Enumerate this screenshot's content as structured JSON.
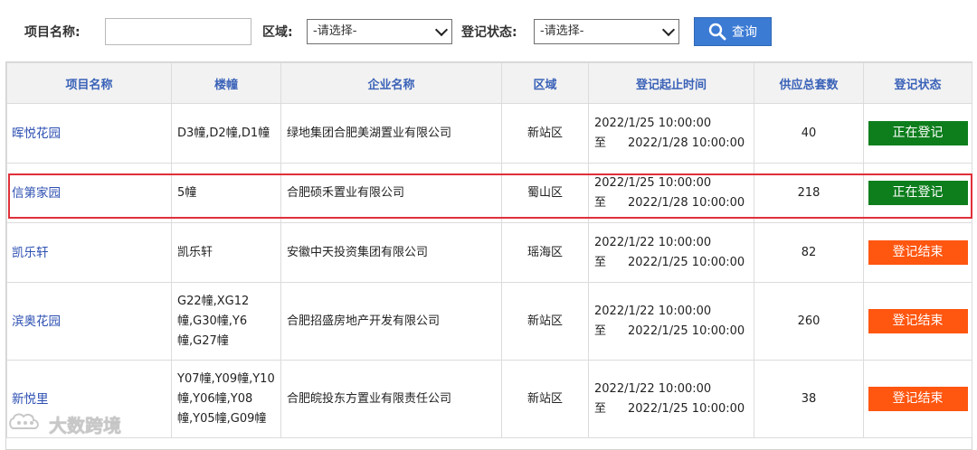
{
  "filters": {
    "project_label": "项目名称:",
    "project_value": "",
    "region_label": "区域:",
    "region_selected": "-请选择-",
    "status_label": "登记状态:",
    "status_selected": "-请选择-",
    "search_label": "查询",
    "search_icon": "search-icon"
  },
  "table": {
    "columns": [
      "项目名称",
      "楼幢",
      "企业名称",
      "区域",
      "登记起止时间",
      "供应总套数",
      "登记状态"
    ],
    "rows": [
      {
        "name": "晖悦花园",
        "buildings": [
          "D3幢,D2幢,D1幢"
        ],
        "enterprise": "绿地集团合肥美湖置业有限公司",
        "area": "新站区",
        "start": "2022/1/25 10:00:00",
        "to": "至",
        "end": "2022/1/28 10:00:00",
        "count": "40",
        "status": "正在登记"
      },
      {
        "name": "信第家园",
        "buildings": [
          "5幢"
        ],
        "enterprise": "合肥硕禾置业有限公司",
        "area": "蜀山区",
        "start": "2022/1/25 10:00:00",
        "to": "至",
        "end": "2022/1/28 10:00:00",
        "count": "218",
        "status": "正在登记"
      },
      {
        "name": "凯乐轩",
        "buildings": [
          "凯乐轩"
        ],
        "enterprise": "安徽中天投资集团有限公司",
        "area": "瑶海区",
        "start": "2022/1/22 10:00:00",
        "to": "至",
        "end": "2022/1/25 10:00:00",
        "count": "82",
        "status": "登记结束"
      },
      {
        "name": "滨奥花园",
        "buildings": [
          "G22幢,XG12",
          "幢,G30幢,Y6",
          "幢,G27幢"
        ],
        "enterprise": "合肥招盛房地产开发有限公司",
        "area": "新站区",
        "start": "2022/1/22 10:00:00",
        "to": "至",
        "end": "2022/1/25 10:00:00",
        "count": "260",
        "status": "登记结束"
      },
      {
        "name": "新悦里",
        "buildings": [
          "Y07幢,Y09幢,Y10",
          "幢,Y06幢,Y08",
          "幢,Y05幢,G09幢"
        ],
        "enterprise": "合肥皖投东方置业有限责任公司",
        "area": "新站区",
        "start": "2022/1/22 10:00:00",
        "to": "至",
        "end": "2022/1/25 10:00:00",
        "count": "38",
        "status": "登记结束"
      }
    ]
  },
  "status_colors": {
    "正在登记": "#0e7e1d",
    "登记结束": "#ff5610"
  },
  "watermark": {
    "text": "大数跨境",
    "icon": "logo-icon"
  }
}
